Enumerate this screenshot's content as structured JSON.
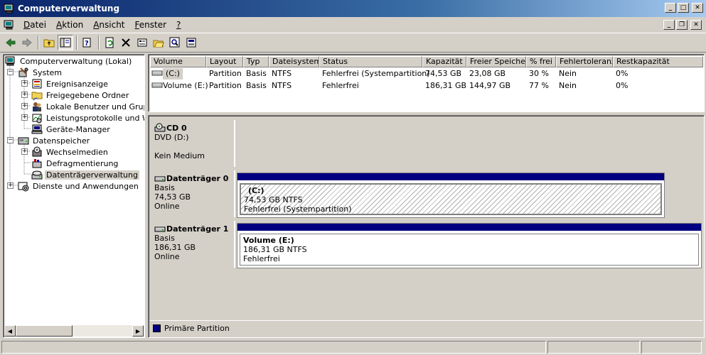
{
  "window": {
    "title": "Computerverwaltung"
  },
  "menu": {
    "items": [
      {
        "label": "Datei",
        "accel": "D",
        "rest": "atei"
      },
      {
        "label": "Aktion",
        "accel": "A",
        "rest": "ktion",
        "pre": ""
      },
      {
        "label": "Ansicht",
        "accel": "A",
        "rest": "nsicht"
      },
      {
        "label": "Fenster",
        "accel": "F",
        "rest": "enster"
      },
      {
        "label": "?",
        "accel": "?",
        "rest": ""
      }
    ]
  },
  "tree": {
    "items": [
      {
        "label": "Computerverwaltung (Lokal)",
        "icon": "computer-icon"
      },
      {
        "label": "System",
        "icon": "system-tools-icon"
      },
      {
        "label": "Ereignisanzeige",
        "icon": "event-viewer-icon"
      },
      {
        "label": "Freigegebene Ordner",
        "icon": "shared-folder-icon"
      },
      {
        "label": "Lokale Benutzer und Gruppen",
        "icon": "users-icon"
      },
      {
        "label": "Leistungsprotokolle und Warnungen",
        "icon": "performance-icon"
      },
      {
        "label": "Geräte-Manager",
        "icon": "device-manager-icon"
      },
      {
        "label": "Datenspeicher",
        "icon": "storage-icon"
      },
      {
        "label": "Wechselmedien",
        "icon": "removable-media-icon"
      },
      {
        "label": "Defragmentierung",
        "icon": "defrag-icon"
      },
      {
        "label": "Datenträgerverwaltung",
        "icon": "disk-management-icon"
      },
      {
        "label": "Dienste und Anwendungen",
        "icon": "services-icon"
      }
    ]
  },
  "volumes": {
    "headers": [
      "Volume",
      "Layout",
      "Typ",
      "Dateisystem",
      "Status",
      "Kapazität",
      "Freier Speicher",
      "% frei",
      "Fehlertoleranz",
      "Restkapazität"
    ],
    "rows": [
      [
        "(C:)",
        "Partition",
        "Basis",
        "NTFS",
        "Fehlerfrei (Systempartition)",
        "74,53 GB",
        "23,08 GB",
        "30 %",
        "Nein",
        "0%"
      ],
      [
        "Volume  (E:)",
        "Partition",
        "Basis",
        "NTFS",
        "Fehlerfrei",
        "186,31 GB",
        "144,97 GB",
        "77 %",
        "Nein",
        "0%"
      ]
    ]
  },
  "disks": {
    "cd0": {
      "name": "CD 0",
      "type": "DVD (D:)",
      "media": "Kein Medium"
    },
    "disk0": {
      "name": "Datenträger 0",
      "kind": "Basis",
      "size": "74,53 GB",
      "state": "Online",
      "partition": {
        "label": "(C:)",
        "size": "74,53 GB NTFS",
        "status": "Fehlerfrei (Systempartition)"
      }
    },
    "disk1": {
      "name": "Datenträger 1",
      "kind": "Basis",
      "size": "186,31 GB",
      "state": "Online",
      "partition": {
        "label": "Volume  (E:)",
        "size": "186,31 GB NTFS",
        "status": "Fehlerfrei"
      }
    }
  },
  "legend": {
    "primary": "Primäre Partition",
    "color": "#000080"
  },
  "colors": {
    "title_start": "#0a246a",
    "title_end": "#a6caf0",
    "partition_bar": "#000080"
  }
}
